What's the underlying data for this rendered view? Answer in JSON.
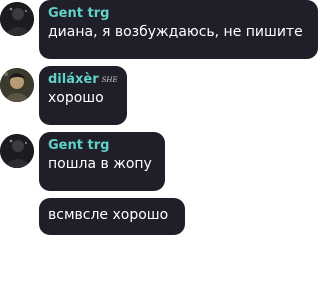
{
  "colors": {
    "bubble": "#1f1e29",
    "text": "#ffffff",
    "author_gent": "#5fd3c6",
    "author_dilaxer": "#5fd3c6"
  },
  "messages": [
    {
      "author": "Gent trg",
      "text": "диана, я возбуждаюсь, не пишите"
    },
    {
      "author": "diláxèr",
      "badge": "SHE",
      "text": "хорошо"
    },
    {
      "author": "Gent trg",
      "text": "пошла в жопу"
    },
    {
      "text": "всмвсле хорошо"
    }
  ]
}
